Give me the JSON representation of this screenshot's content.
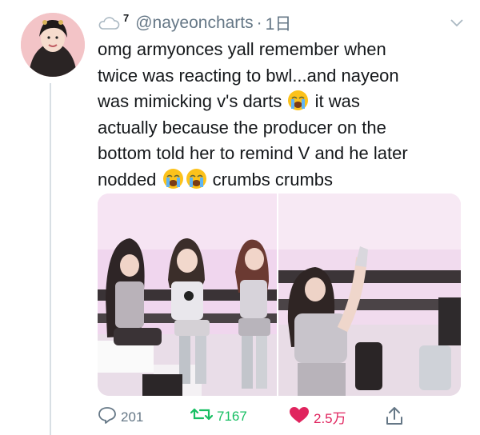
{
  "tweet": {
    "badge_number": "7",
    "handle": "@nayeoncharts",
    "separator": "·",
    "time": "1日",
    "text_lines": [
      "omg armyonces yall remember when",
      "twice was reacting to bwl...and nayeon",
      "was mimicking v's darts",
      "it was",
      "actually because the producer on the",
      "bottom told her to remind V and he later",
      "nodded",
      "crumbs crumbs"
    ]
  },
  "actions": {
    "reply_count": "201",
    "retweet_count": "7167",
    "like_count": "2.5万"
  },
  "colors": {
    "retweet": "#17bf63",
    "like": "#e0245e",
    "muted": "#657786"
  }
}
